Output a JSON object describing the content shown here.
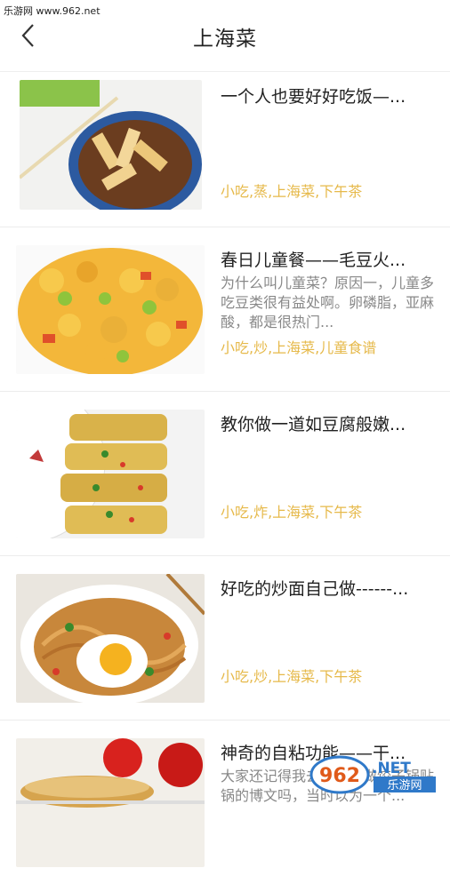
{
  "watermark_top": "乐游网 www.962.net",
  "header": {
    "title": "上海菜",
    "back_icon": "chevron-left-icon"
  },
  "items": [
    {
      "title": "一个人也要好好吃饭—...",
      "desc": "",
      "tags": "小吃,蒸,上海菜,下午茶"
    },
    {
      "title": "春日儿童餐——毛豆火...",
      "desc": "为什么叫儿童菜？原因一，儿童多吃豆类很有益处啊。卵磷脂，亚麻酸，都是很热门...",
      "tags": "小吃,炒,上海菜,儿童食谱"
    },
    {
      "title": "教你做一道如豆腐般嫩...",
      "desc": "",
      "tags": "小吃,炸,上海菜,下午茶"
    },
    {
      "title": "好吃的炒面自己做------...",
      "desc": "",
      "tags": "小吃,炒,上海菜,下午茶"
    },
    {
      "title": "神奇的自粘功能——干...",
      "desc": "大家还记得我去年写的做饺子锅贴锅的博文吗，当时以为一个...",
      "tags": ""
    }
  ],
  "brand_watermark": {
    "logo_text": "962",
    "net_text": ".NET",
    "sub_text": "乐游网"
  },
  "colors": {
    "tag": "#e6b94a",
    "title": "#222222",
    "desc": "#888888"
  }
}
